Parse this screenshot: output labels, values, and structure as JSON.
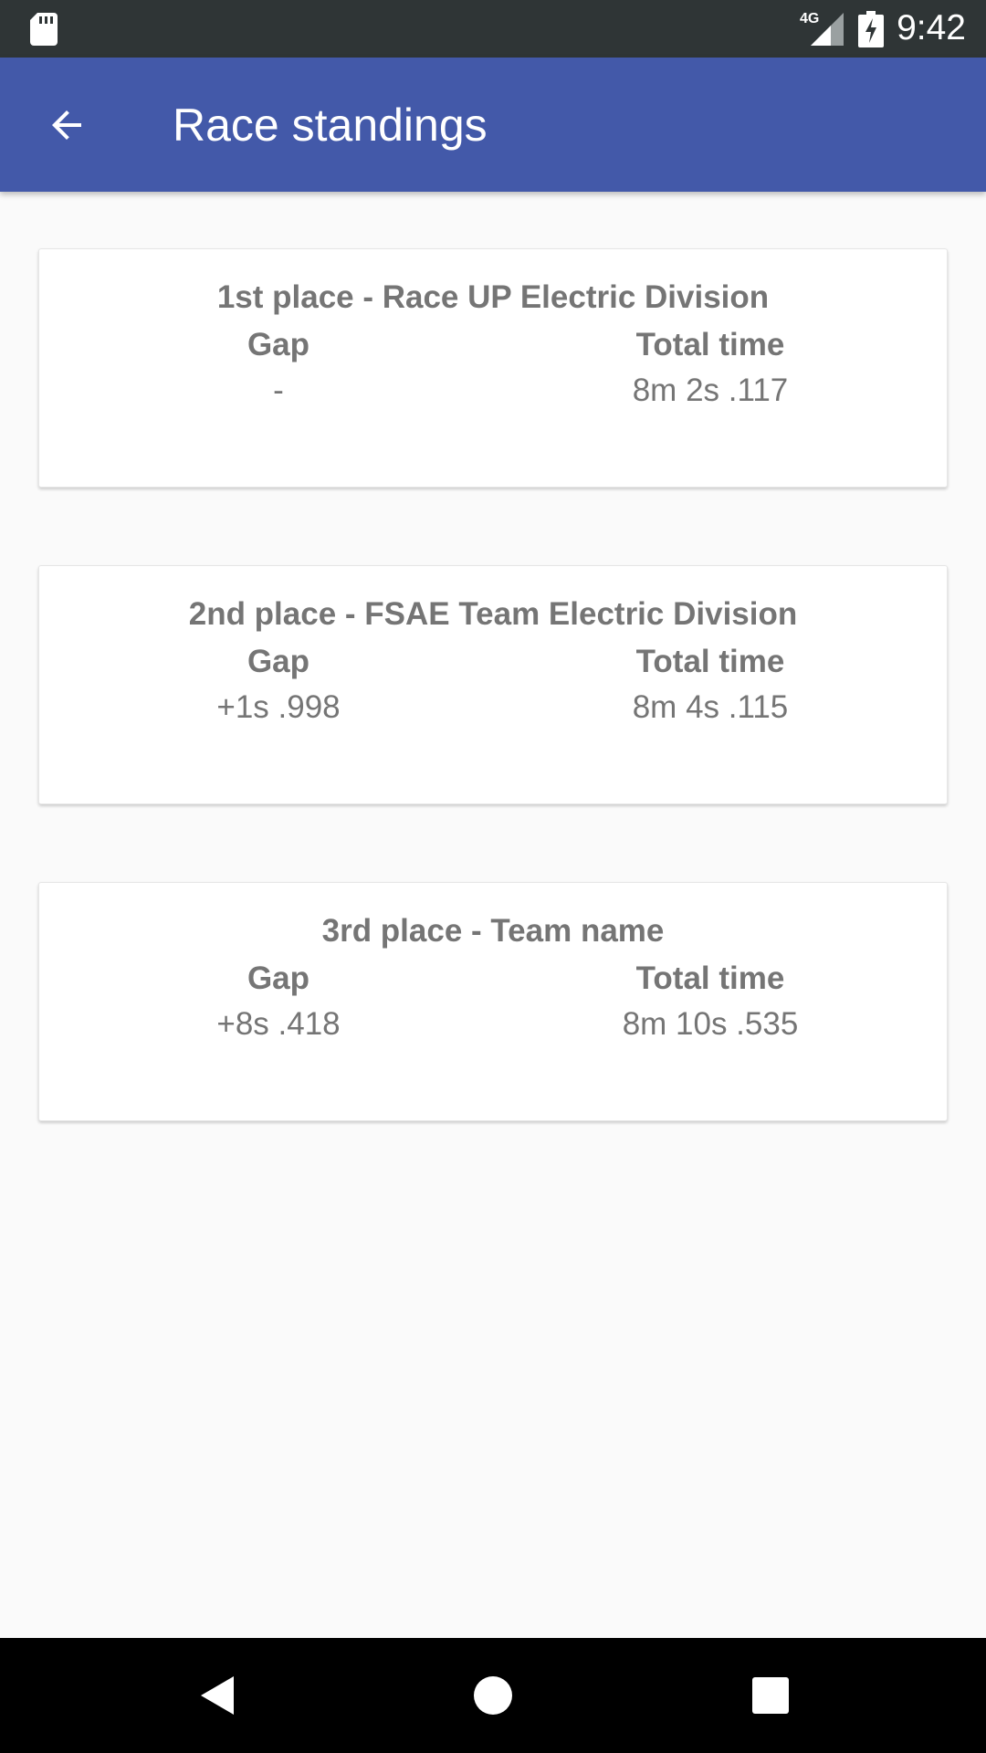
{
  "status_bar": {
    "network": "4G",
    "time": "9:42",
    "icons": [
      "sd-card-icon",
      "signal-icon",
      "battery-charging-icon"
    ]
  },
  "app_bar": {
    "title": "Race standings",
    "back_icon": "arrow-back-icon"
  },
  "standings": [
    {
      "title": "1st place - Race UP Electric Division",
      "gap_label": "Gap",
      "gap": "-",
      "total_label": "Total time",
      "total": "8m 2s .117"
    },
    {
      "title": "2nd place - FSAE Team Electric Division",
      "gap_label": "Gap",
      "gap": "+1s .998",
      "total_label": "Total time",
      "total": "8m 4s .115"
    },
    {
      "title": "3rd place - Team name",
      "gap_label": "Gap",
      "gap": "+8s .418",
      "total_label": "Total time",
      "total": "8m 10s .535"
    }
  ],
  "nav_bar": {
    "icons": [
      "nav-back-icon",
      "nav-home-icon",
      "nav-recents-icon"
    ]
  },
  "colors": {
    "status_bar": "#2f3536",
    "app_bar": "#4359a9",
    "background": "#fafafa",
    "card_text": "#757575"
  }
}
